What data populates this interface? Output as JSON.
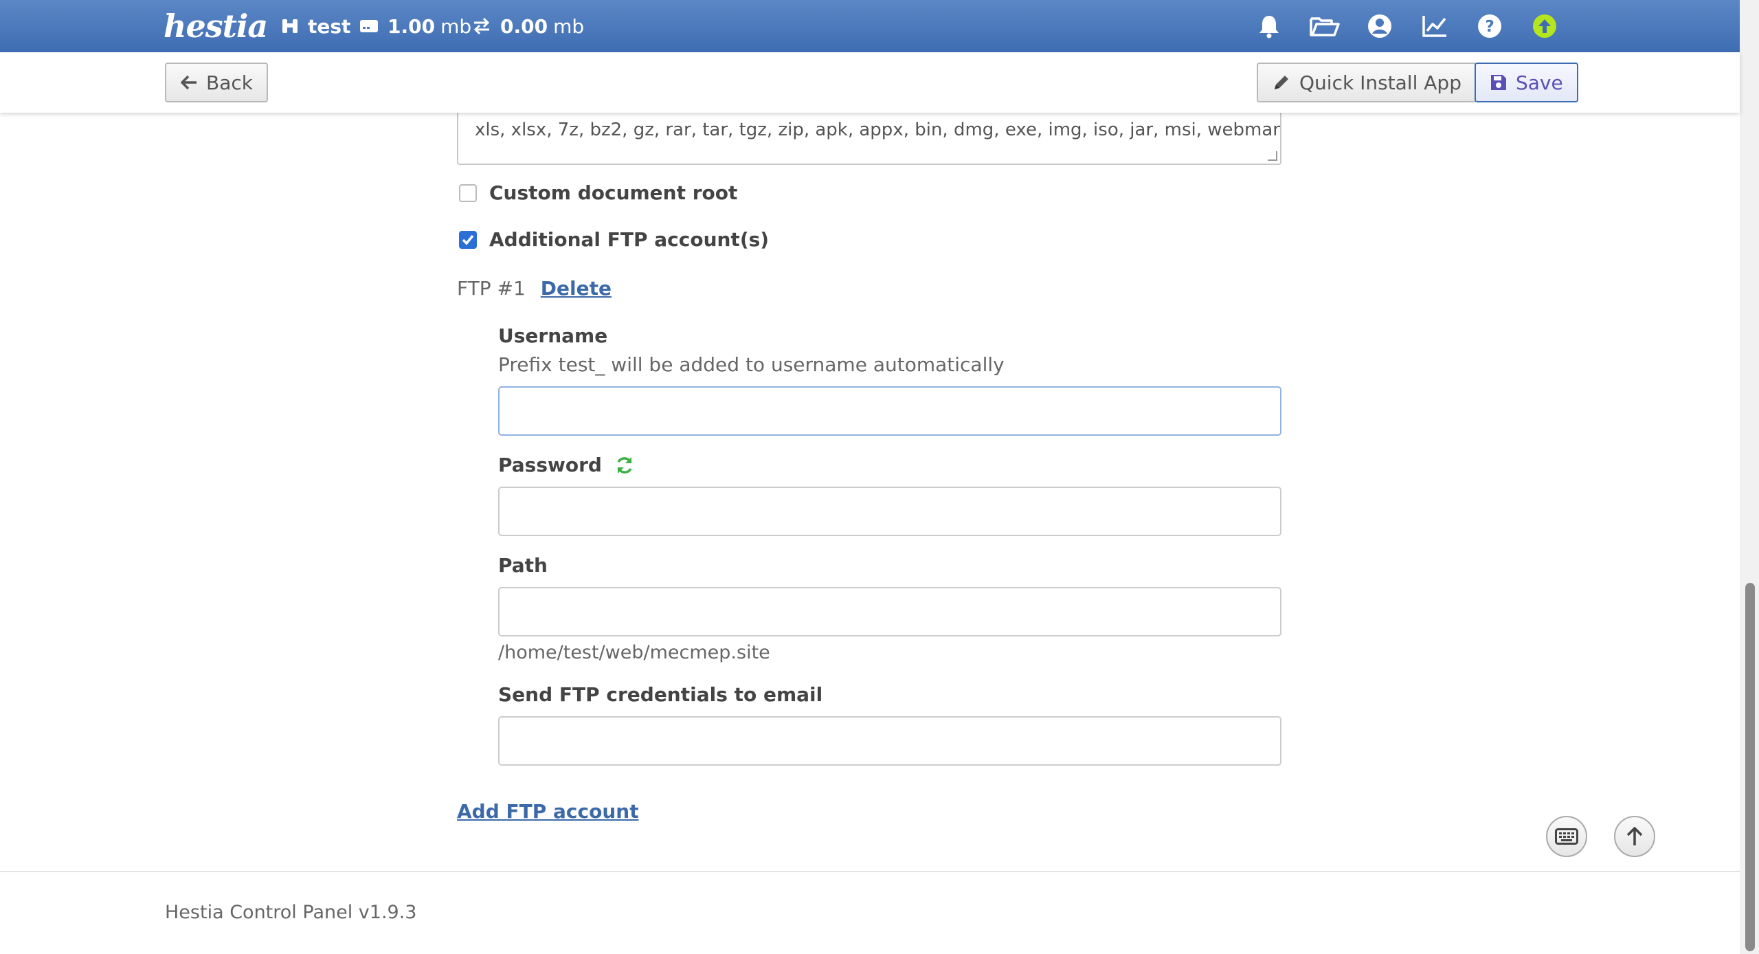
{
  "topbar": {
    "logo": "hestia",
    "user": "test",
    "disk_value": "1.00",
    "disk_unit": "mb",
    "bandwidth_value": "0.00",
    "bandwidth_unit": "mb",
    "icons": [
      "bell-icon",
      "folder-open-icon",
      "user-circle-icon",
      "chart-line-icon",
      "question-circle-icon",
      "arrow-up-circle-icon"
    ]
  },
  "toolbar": {
    "back_label": "Back",
    "quick_install_label": "Quick Install App",
    "save_label": "Save"
  },
  "form": {
    "extensions_line": "xls, xlsx, 7z, bz2, gz, rar, tar, tgz, zip, apk, appx, bin, dmg, exe, img, iso, jar, msi, webmanifest",
    "custom_docroot_label": "Custom document root",
    "custom_docroot_checked": false,
    "additional_ftp_label": "Additional FTP account(s)",
    "additional_ftp_checked": true,
    "ftp": {
      "header": "FTP #1",
      "delete_label": "Delete",
      "username_label": "Username",
      "username_hint": "Prefix test_ will be added to username automatically",
      "username_value": "",
      "password_label": "Password",
      "password_value": "",
      "path_label": "Path",
      "path_value": "",
      "path_hint": "/home/test/web/mecmep.site",
      "email_label": "Send FTP credentials to email",
      "email_value": ""
    },
    "add_ftp_label": "Add FTP account"
  },
  "footer": {
    "text": "Hestia Control Panel v1.9.3"
  },
  "colors": {
    "topbar": "#4a78bc",
    "link": "#3c6aa9",
    "save_icon": "#5a4fb5",
    "refresh_icon": "#3cb043",
    "update_icon": "#b5e61d"
  }
}
